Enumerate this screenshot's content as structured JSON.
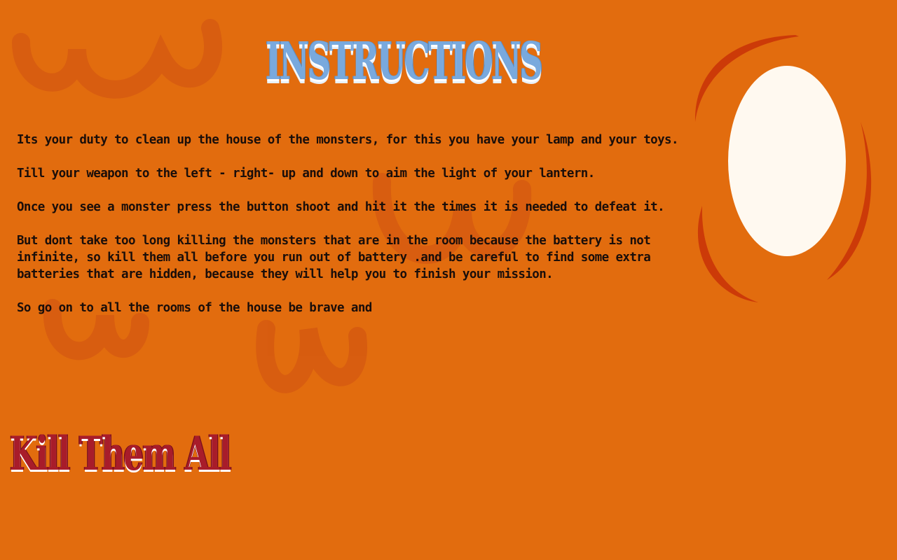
{
  "screen": {
    "title": "Instructions",
    "paragraphs": [
      "Its your duty to clean up the house of the monsters, for this you have your lamp and your toys.",
      "Till  your  weapon  to  the  left - right-  up  and  down  to aim the light of your lantern.",
      "Once you see a monster press the button shoot and hit it the times it is needed to defeat it.",
      "But  dont  take  too  long killing the monsters that are in the room because the battery is not infinite, so kill them all before you run out of battery .and be careful to find some extra batteries that are hidden, because they will help you to finish your mission.",
      "So go on to all the rooms of the house be brave and"
    ],
    "closing_tagline": "Kill Them All"
  },
  "colors": {
    "background": "#E26C0E",
    "title": "#79A9DD",
    "body_text": "#1A0E0A",
    "tagline": "#A81C2A",
    "lantern_ring": "#CC3A08",
    "lantern_light": "#FFF9F0"
  },
  "icons": {
    "lantern": "lantern-light-icon",
    "background_marks": "claw-mark-icon"
  }
}
